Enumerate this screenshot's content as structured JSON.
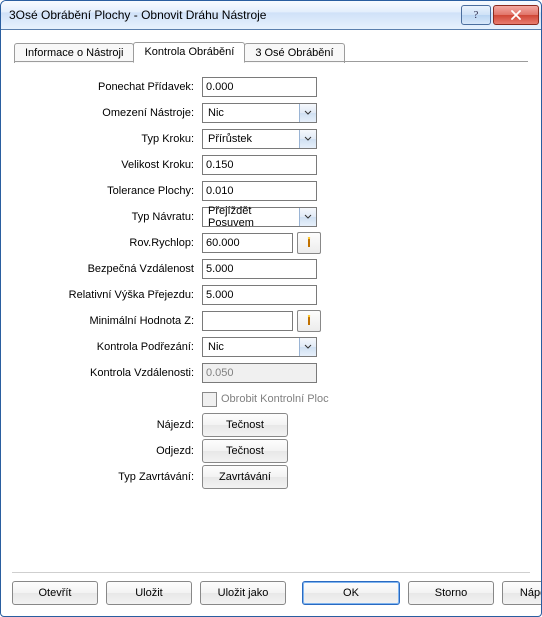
{
  "title": "3Osé Obrábění Plochy - Obnovit Dráhu Nástroje",
  "winbuttons": {
    "help": "?",
    "close": "X"
  },
  "tabs": [
    "Informace o Nástroji",
    "Kontrola Obrábění",
    "3 Osé Obrábění"
  ],
  "activeTab": 1,
  "labels": {
    "ponechat": "Ponechat Přídavek:",
    "omezeni": "Omezení Nástroje:",
    "typkroku": "Typ Kroku:",
    "velikost": "Velikost Kroku:",
    "tolerance": "Tolerance Plochy:",
    "typnavratu": "Typ Návratu:",
    "rovrychlop": "Rov.Rychlop:",
    "bezpecna": "Bezpečná Vzdálenost",
    "relativni": "Relativní Výška Přejezdu:",
    "minz": "Minimální Hodnota Z:",
    "podrezani": "Kontrola Podřezání:",
    "kvzdalenost": "Kontrola Vzdálenosti:",
    "obrobit": "Obrobit Kontrolní Ploc",
    "najezd": "Nájezd:",
    "odjezd": "Odjezd:",
    "typzavrt": "Typ Zavrtávání:"
  },
  "fields": {
    "ponechat": "0.000",
    "omezeni": "Nic",
    "typkroku": "Přírůstek",
    "velikost": "0.150",
    "tolerance": "0.010",
    "typnavratu": "Přejíždět Posuvem",
    "rovrychlop": "60.000",
    "bezpecna": "5.000",
    "relativni": "5.000",
    "minz": "",
    "podrezani": "Nic",
    "kvzdalenost": "0.050",
    "najezd_btn": "Tečnost",
    "odjezd_btn": "Tečnost",
    "zavrt_btn": "Zavrtávání"
  },
  "buttons": {
    "open": "Otevřít",
    "save": "Uložit",
    "saveas": "Uložit jako",
    "ok": "OK",
    "storno": "Storno",
    "help": "Nápověda"
  }
}
